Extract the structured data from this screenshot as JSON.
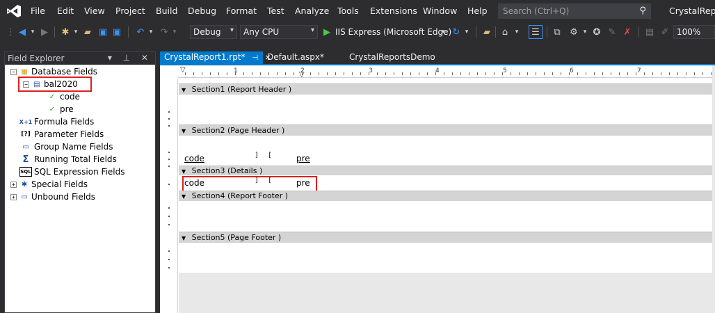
{
  "menu": {
    "items": [
      "File",
      "Edit",
      "View",
      "Project",
      "Build",
      "Debug",
      "Format",
      "Test",
      "Analyze",
      "Tools",
      "Extensions",
      "Window",
      "Help"
    ],
    "search_placeholder": "Search (Ctrl+Q)",
    "app_title": "CrystalReportsDemo"
  },
  "toolbar": {
    "config": "Debug",
    "platform": "Any CPU",
    "run_target": "IIS Express (Microsoft Edge)",
    "zoom": "100%"
  },
  "field_explorer": {
    "title": "Field Explorer",
    "header_buttons": "▾ ⊥ ✕",
    "items": [
      {
        "label": "Database Fields",
        "expander": "−",
        "icon": "▦"
      },
      {
        "label": "bal2020",
        "expander": "−",
        "icon": "▤"
      },
      {
        "label": "code",
        "icon": "✓"
      },
      {
        "label": "pre",
        "icon": "✓"
      },
      {
        "label": "Formula Fields",
        "icon": "X+1"
      },
      {
        "label": "Parameter Fields",
        "icon": "[?]"
      },
      {
        "label": "Group Name Fields",
        "icon": "▭"
      },
      {
        "label": "Running Total Fields",
        "icon": "Σ"
      },
      {
        "label": "SQL Expression Fields",
        "icon": "SQL"
      },
      {
        "label": "Special Fields",
        "expander": "+",
        "icon": "✱"
      },
      {
        "label": "Unbound Fields",
        "expander": "+",
        "icon": "▭"
      }
    ]
  },
  "tabs": [
    {
      "label": "CrystalReport1.rpt*",
      "pin": "⊣",
      "close": "✕",
      "active": true
    },
    {
      "label": "Default.aspx*",
      "active": false
    },
    {
      "label": "CrystalReportsDemo",
      "active": false
    }
  ],
  "ruler": {
    "numbers": [
      "1",
      "2",
      "3",
      "4",
      "5",
      "6",
      "7"
    ]
  },
  "report": {
    "sections": [
      {
        "label": "Section1 (Report Header )"
      },
      {
        "label": "Section2 (Page Header )"
      },
      {
        "label": "Section3 (Details )"
      },
      {
        "label": "Section4 (Report Footer )"
      },
      {
        "label": "Section5 (Page Footer )"
      }
    ],
    "header_fields": {
      "code": "code",
      "pre": "pre"
    },
    "detail_fields": {
      "code": "code",
      "pre": "pre"
    }
  },
  "colors": {
    "accent": "#007acc",
    "highlight": "#e01e1e"
  }
}
